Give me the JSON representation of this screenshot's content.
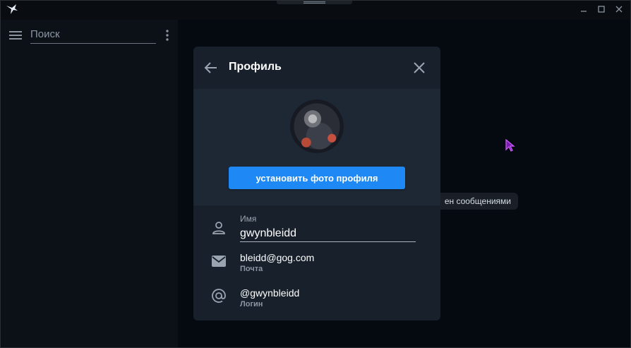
{
  "search": {
    "placeholder": "Поиск"
  },
  "background_chip": {
    "text": "ен сообщениями"
  },
  "profile": {
    "title": "Профиль",
    "set_photo_label": "установить фото профиля",
    "name_label": "Имя",
    "name_value": "gwynbleidd",
    "email_value": "bleidd@gog.com",
    "email_caption": "Почта",
    "login_value": "@gwynbleidd",
    "login_caption": "Логин"
  },
  "icons": {
    "app_logo": "swallow-logo-icon",
    "menu": "hamburger-menu-icon",
    "more": "more-vertical-icon",
    "back": "arrow-left-icon",
    "close": "close-icon",
    "person": "person-icon",
    "email": "envelope-icon",
    "at": "at-sign-icon",
    "cursor": "mouse-cursor-icon"
  },
  "colors": {
    "accent": "#1e88f5",
    "modal_bg": "#17202b",
    "photo_section_bg": "#1e2835",
    "sidebar_bg": "#0c1117",
    "cursor": "#c040ff"
  }
}
